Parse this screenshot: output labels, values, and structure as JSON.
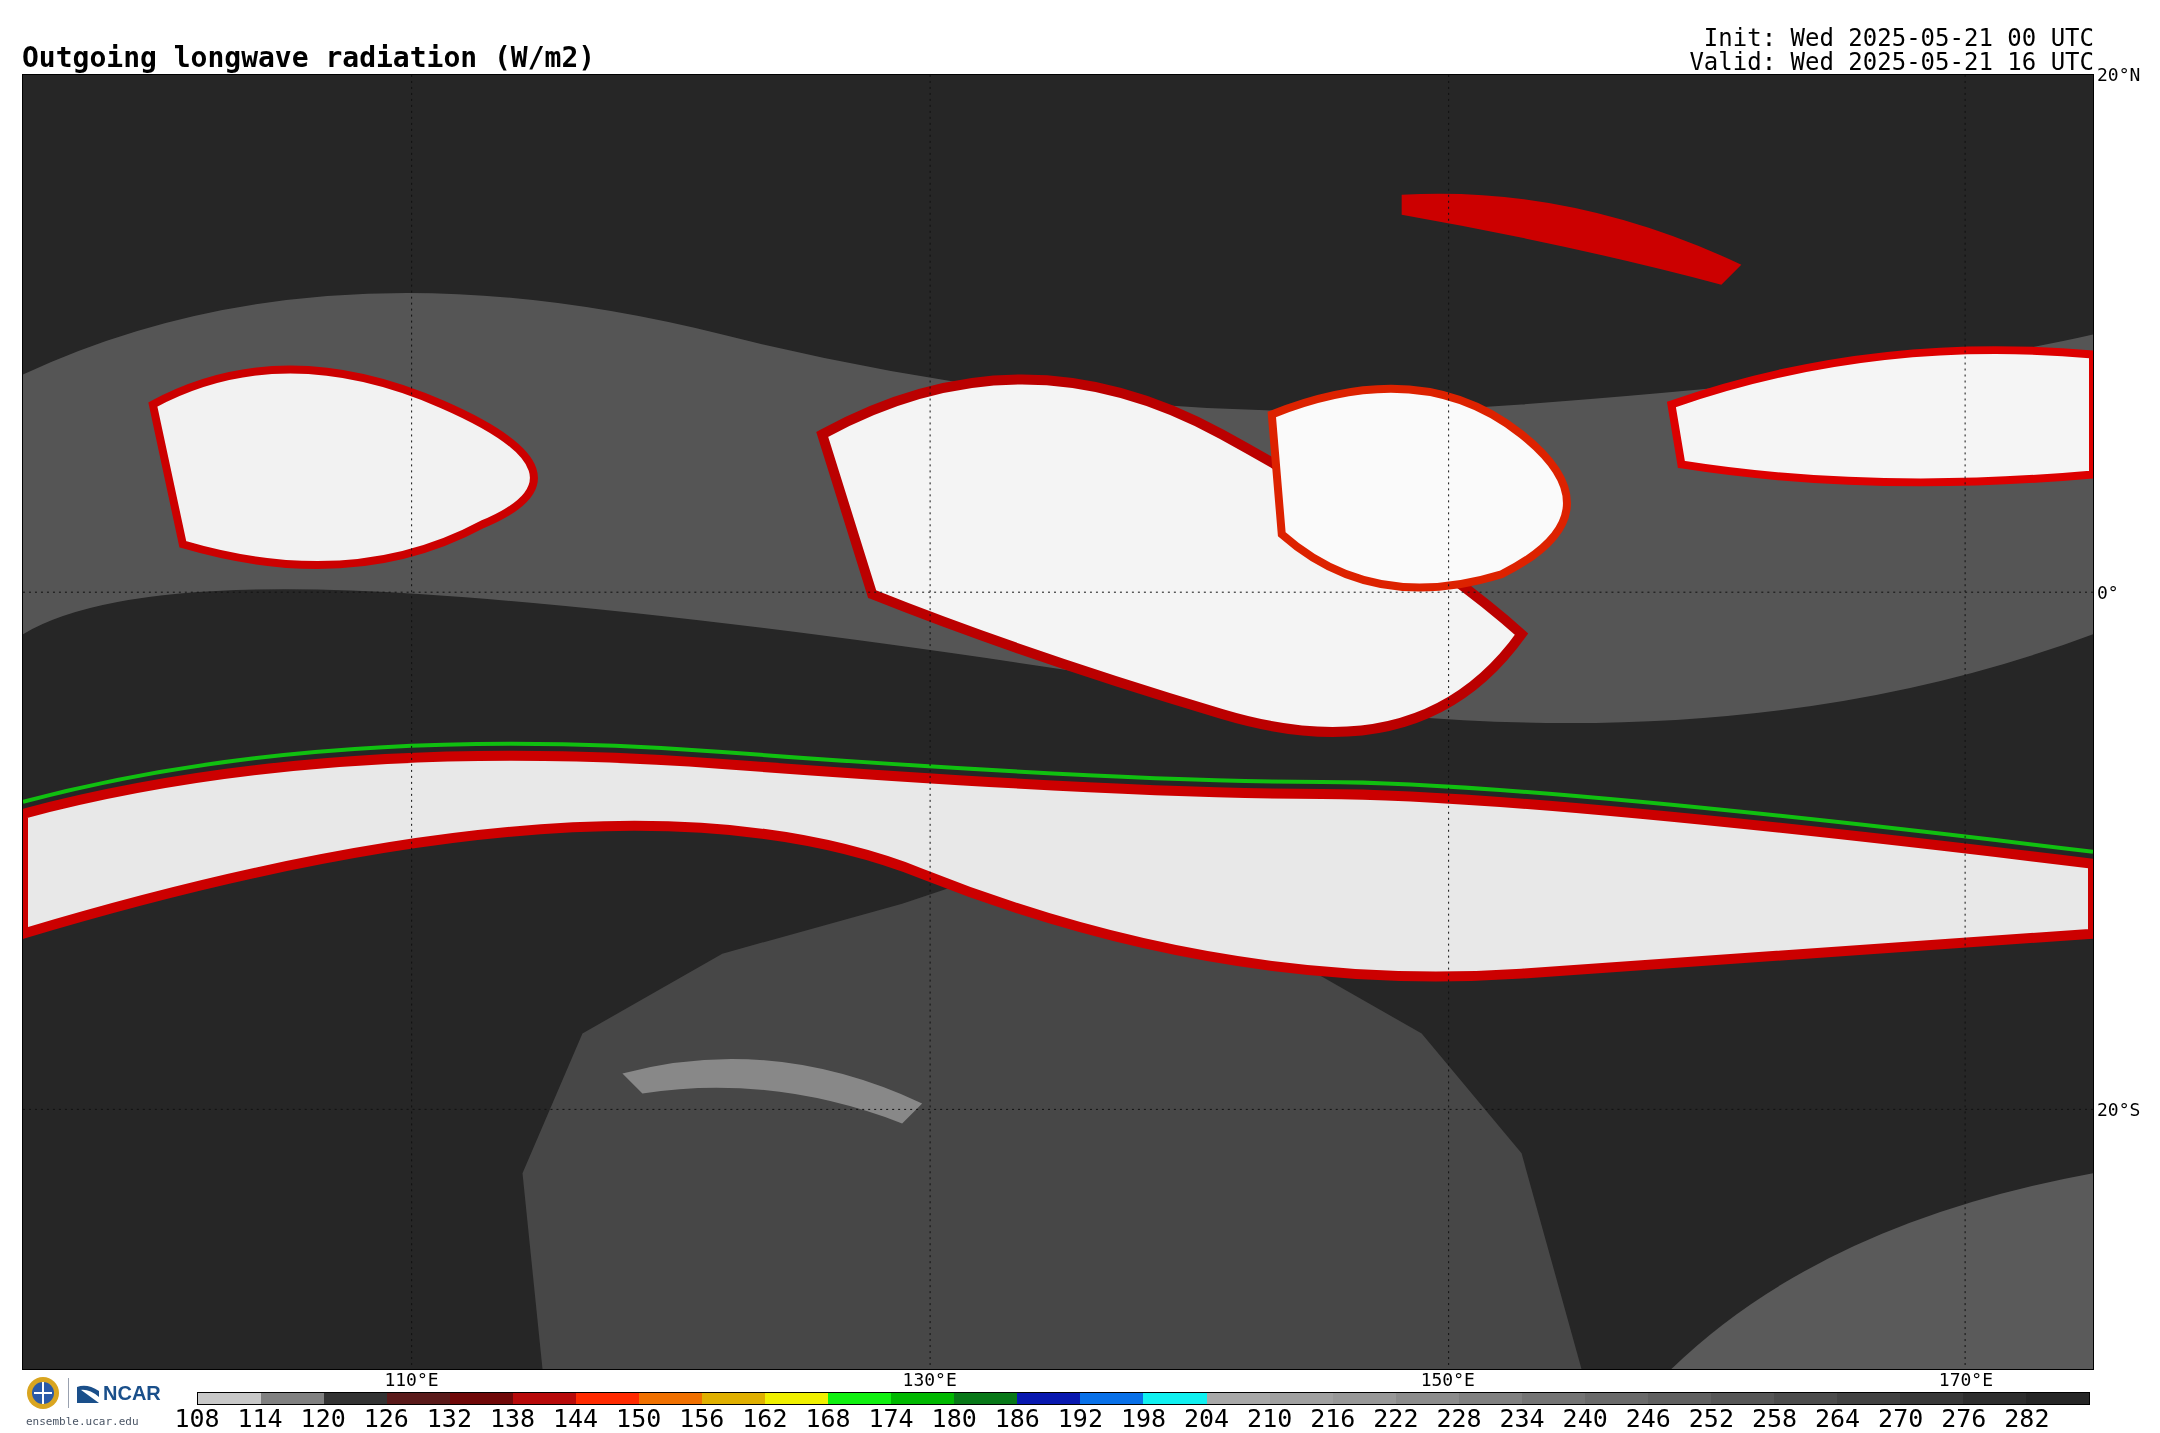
{
  "title": "Outgoing longwave radiation (W/m2)",
  "init": "Init: Wed 2025-05-21 00 UTC",
  "valid": "Valid: Wed 2025-05-21 16 UTC",
  "map": {
    "lat_labels": [
      "20°N",
      "0°",
      "20°S"
    ],
    "lon_labels": [
      "110°E",
      "130°E",
      "150°E",
      "170°E"
    ]
  },
  "logo": {
    "text": "NCAR",
    "url": "ensemble.ucar.edu"
  },
  "colorbar": {
    "segments": [
      {
        "color": "#c8c8c8"
      },
      {
        "color": "#808080"
      },
      {
        "color": "#333333"
      },
      {
        "color": "#5a1a1a"
      },
      {
        "color": "#700808"
      },
      {
        "color": "#b80a0a"
      },
      {
        "color": "#ff2a00"
      },
      {
        "color": "#f07000"
      },
      {
        "color": "#e0b000"
      },
      {
        "color": "#f0f000"
      },
      {
        "color": "#10f010"
      },
      {
        "color": "#00b800"
      },
      {
        "color": "#087818"
      },
      {
        "color": "#0818b0"
      },
      {
        "color": "#0870e8"
      },
      {
        "color": "#10f0f0"
      },
      {
        "color": "#a8a8a8"
      },
      {
        "color": "#a0a0a0"
      },
      {
        "color": "#989898"
      },
      {
        "color": "#8c8c8c"
      },
      {
        "color": "#808080"
      },
      {
        "color": "#747474"
      },
      {
        "color": "#6a6a6a"
      },
      {
        "color": "#606060"
      },
      {
        "color": "#565656"
      },
      {
        "color": "#4c4c4c"
      },
      {
        "color": "#424242"
      },
      {
        "color": "#383838"
      },
      {
        "color": "#2e2e2e"
      },
      {
        "color": "#262626"
      }
    ],
    "ticks": [
      "108",
      "114",
      "120",
      "126",
      "132",
      "138",
      "144",
      "150",
      "156",
      "162",
      "168",
      "174",
      "180",
      "186",
      "192",
      "198",
      "204",
      "210",
      "216",
      "222",
      "228",
      "234",
      "240",
      "246",
      "252",
      "258",
      "264",
      "270",
      "276",
      "282"
    ]
  }
}
